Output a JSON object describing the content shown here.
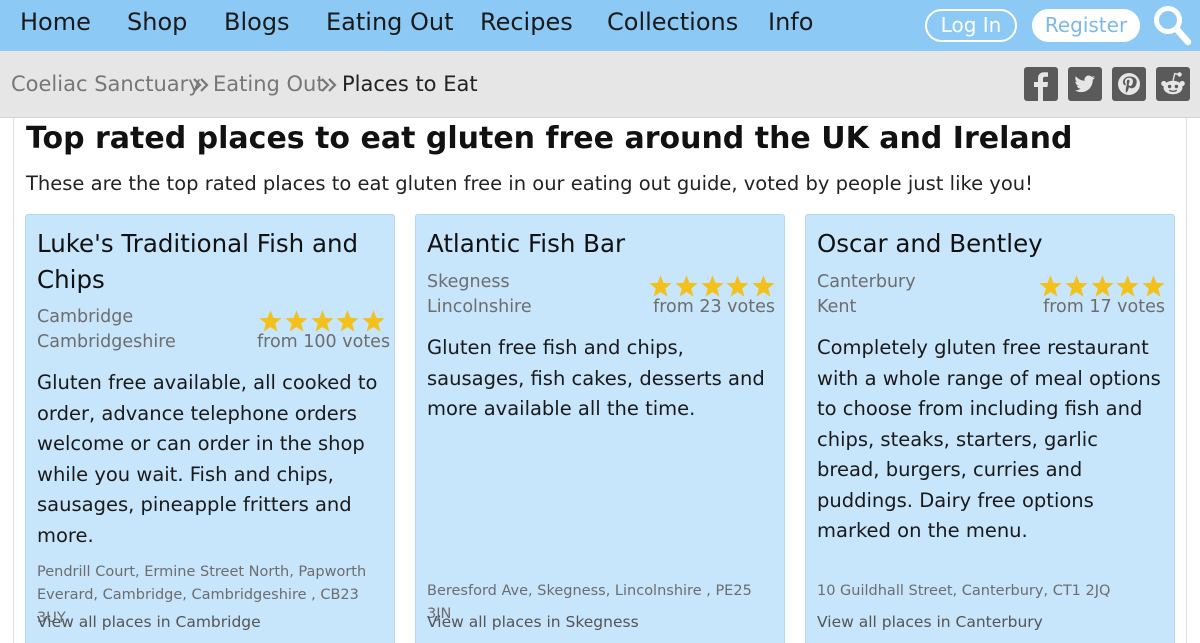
{
  "nav": {
    "items": [
      "Home",
      "Shop",
      "Blogs",
      "Eating Out",
      "Recipes",
      "Collections",
      "Info"
    ],
    "login": "Log In",
    "register": "Register",
    "search_icon": "search-icon"
  },
  "breadcrumb": {
    "items": [
      "Coeliac Sanctuary",
      "Eating Out",
      "Places to Eat"
    ],
    "separator_icon": "double-chevron-right-icon"
  },
  "social": [
    "facebook-icon",
    "twitter-icon",
    "pinterest-icon",
    "reddit-icon"
  ],
  "colors": {
    "nav_bg": "#8dc9f5",
    "breadcrumb_bg": "#e6e6e6",
    "card_bg": "#c7e5fb",
    "star": "#f3c11b",
    "social_icon": "#5a5a5a"
  },
  "main": {
    "title": "Top rated places to eat gluten free around the UK and Ireland",
    "intro": "These are the top rated places to eat gluten free in our eating out guide, voted by people just like you!"
  },
  "places": [
    {
      "name": "Luke's Traditional Fish and Chips",
      "town": "Cambridge",
      "county": "Cambridgeshire",
      "rating": 5,
      "votes": "from 100 votes",
      "description": "Gluten free available, all cooked to order, advance telephone orders welcome or can order in the shop while you wait. Fish and chips, sausages, pineapple fritters and more.",
      "address": "Pendrill Court, Ermine Street North, Papworth Everard, Cambridge, Cambridgeshire , CB23 3UY",
      "view_all": "View all places in Cambridge"
    },
    {
      "name": "Atlantic Fish Bar",
      "town": "Skegness",
      "county": "Lincolnshire",
      "rating": 5,
      "votes": "from 23 votes",
      "description": "Gluten free fish and chips, sausages, fish cakes, desserts and more available all the time.",
      "address": "Beresford Ave, Skegness, Lincolnshire , PE25 3JN",
      "view_all": "View all places in Skegness"
    },
    {
      "name": "Oscar and Bentley",
      "town": "Canterbury",
      "county": "Kent",
      "rating": 5,
      "votes": "from 17 votes",
      "description": "Completely gluten free restaurant with a whole range of meal options to choose from including fish and chips, steaks, starters, garlic bread, burgers, curries and puddings. Dairy free options marked on the menu.",
      "address": "10 Guildhall Street, Canterbury, CT1 2JQ",
      "view_all": "View all places in Canterbury"
    }
  ]
}
